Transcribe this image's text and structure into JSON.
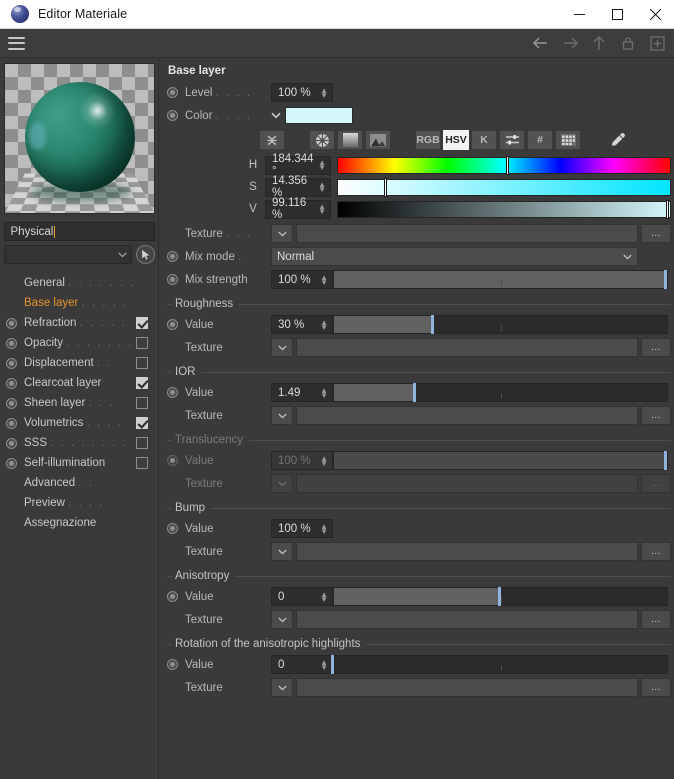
{
  "window": {
    "title": "Editor Materiale",
    "app_icon": "material-sphere-icon",
    "minimize": "–",
    "maximize": "□",
    "close": "✕"
  },
  "toolbar": {
    "menu_icon": "hamburger-icon",
    "nav": [
      {
        "name": "back-arrow-icon",
        "glyph": "←",
        "active": true
      },
      {
        "name": "forward-arrow-icon",
        "glyph": "→",
        "active": false
      },
      {
        "name": "up-arrow-icon",
        "glyph": "↑",
        "active": false
      },
      {
        "name": "lock-icon",
        "glyph": "◯",
        "active": false
      },
      {
        "name": "add-box-icon",
        "glyph": "⊞",
        "active": false
      }
    ]
  },
  "sidebar": {
    "preview_name": "material-preview-sphere",
    "material_name": "Physical",
    "type_combo_value": "",
    "picker_icon": "cursor-picker-icon",
    "items": [
      {
        "label": "General",
        "dots": ". . . . . . .",
        "radio": false,
        "checkbox": null,
        "selected": false
      },
      {
        "label": "Base layer",
        "dots": ". . . . .",
        "radio": false,
        "checkbox": null,
        "selected": true
      },
      {
        "label": "Refraction",
        "dots": ". . . . .",
        "radio": true,
        "checkbox": true,
        "selected": false
      },
      {
        "label": "Opacity",
        "dots": ". . . . . . .",
        "radio": true,
        "checkbox": false,
        "selected": false
      },
      {
        "label": "Displacement",
        "dots": ". .",
        "radio": true,
        "checkbox": false,
        "selected": false
      },
      {
        "label": "Clearcoat layer",
        "dots": "",
        "radio": true,
        "checkbox": true,
        "selected": false
      },
      {
        "label": "Sheen layer",
        "dots": ". . .",
        "radio": true,
        "checkbox": false,
        "selected": false
      },
      {
        "label": "Volumetrics",
        "dots": ". . . .",
        "radio": true,
        "checkbox": true,
        "selected": false
      },
      {
        "label": "SSS",
        "dots": ". . . . . . . .",
        "radio": true,
        "checkbox": false,
        "selected": false
      },
      {
        "label": "Self-illumination",
        "dots": "",
        "radio": true,
        "checkbox": false,
        "selected": false
      },
      {
        "label": "Advanced",
        "dots": ". .",
        "radio": false,
        "checkbox": null,
        "selected": false
      },
      {
        "label": "Preview",
        "dots": ". . . .",
        "radio": false,
        "checkbox": null,
        "selected": false
      },
      {
        "label": "Assegnazione",
        "dots": "",
        "radio": false,
        "checkbox": null,
        "selected": false
      }
    ]
  },
  "main": {
    "section_title": "Base layer",
    "level": {
      "label": "Level",
      "dots": ". . . .",
      "value": "100 %"
    },
    "color": {
      "label": "Color",
      "dots": ". . . .",
      "swatch_hex": "#d4f7fc"
    },
    "color_modes": {
      "collapse_icon": "collapse-arrows-icon",
      "wheel_icon": "color-wheel-icon",
      "gradient_icon": "gradient-swatch-icon",
      "image_icon": "image-mountain-icon",
      "buttons": [
        {
          "label": "RGB",
          "active": false
        },
        {
          "label": "HSV",
          "active": true
        },
        {
          "label": "K",
          "active": false
        }
      ],
      "sliders_icon": "sliders-icon",
      "hash_icon": "hash-icon",
      "grid_icon": "swatch-grid-icon",
      "eyedropper_icon": "eyedropper-icon"
    },
    "hsv": [
      {
        "label": "H",
        "value": "184.344 °",
        "pos_pct": 51.2
      },
      {
        "label": "S",
        "value": "14.356 %",
        "pos_pct": 14.4
      },
      {
        "label": "V",
        "value": "99.116 %",
        "pos_pct": 99.1
      }
    ],
    "texture_row": {
      "label": "Texture",
      "dots": ". . .",
      "value": "",
      "ellipsis": "...",
      "dropdown_icon": "chevron-down-icon"
    },
    "mix_mode": {
      "label": "Mix mode",
      "dots": ".",
      "value": "Normal",
      "dropdown_icon": "chevron-down-icon"
    },
    "mix_strength": {
      "label": "Mix strength",
      "dots": "",
      "value": "100 %",
      "pos_pct": 100
    },
    "groups": [
      {
        "title": "Roughness",
        "enabled": true,
        "value_label": "Value",
        "value": "30 %",
        "pos_pct": 30,
        "has_slider": true,
        "texture_label": "Texture",
        "texture_value": "",
        "ellipsis": "..."
      },
      {
        "title": "IOR",
        "enabled": true,
        "value_label": "Value",
        "value": "1.49",
        "pos_pct": 24.5,
        "has_slider": true,
        "texture_label": "Texture",
        "texture_value": "",
        "ellipsis": "..."
      },
      {
        "title": "Translucency",
        "enabled": false,
        "value_label": "Value",
        "value": "100 %",
        "pos_pct": 100,
        "has_slider": true,
        "texture_label": "Texture",
        "texture_value": "",
        "ellipsis": "..."
      },
      {
        "title": "Bump",
        "enabled": true,
        "value_label": "Value",
        "value": "100 %",
        "pos_pct": 0,
        "has_slider": false,
        "texture_label": "Texture",
        "texture_value": "",
        "ellipsis": "..."
      },
      {
        "title": "Anisotropy",
        "enabled": true,
        "value_label": "Value",
        "value": "0",
        "pos_pct": 50,
        "has_slider": true,
        "texture_label": "Texture",
        "texture_value": "",
        "ellipsis": "..."
      },
      {
        "title": "Rotation of the anisotropic highlights",
        "enabled": true,
        "value_label": "Value",
        "value": "0",
        "pos_pct": 0,
        "has_slider": true,
        "texture_label": "Texture",
        "texture_value": "",
        "ellipsis": "..."
      }
    ]
  }
}
